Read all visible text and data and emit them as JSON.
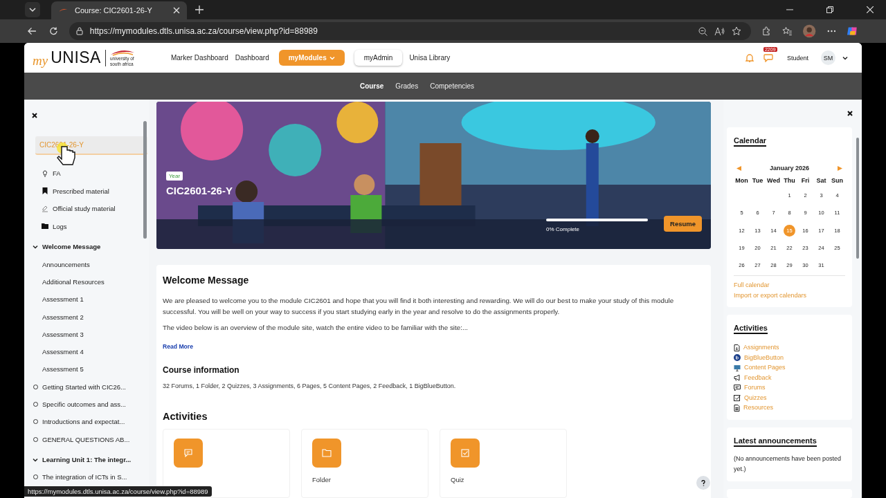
{
  "browser": {
    "tab_title": "Course: CIC2601-26-Y",
    "url": "https://mymodules.dtls.unisa.ac.za/course/view.php?id=88989",
    "status_url": "https://mymodules.dtls.unisa.ac.za/course/view.php?id=88989"
  },
  "header": {
    "logo": {
      "my": "my",
      "name": "UNISA",
      "tagline": "university of south africa"
    },
    "nav": [
      {
        "label": "Marker Dashboard",
        "kind": "link"
      },
      {
        "label": "Dashboard",
        "kind": "link"
      },
      {
        "label": "myModules",
        "kind": "primary"
      },
      {
        "label": "myAdmin",
        "kind": "secondary"
      },
      {
        "label": "Unisa Library",
        "kind": "link"
      }
    ],
    "message_count": "2209",
    "role": "Student",
    "initials": "SM"
  },
  "secondary_nav": [
    {
      "label": "Course",
      "selected": true
    },
    {
      "label": "Grades",
      "selected": false
    },
    {
      "label": "Competencies",
      "selected": false
    }
  ],
  "course_index": {
    "course": {
      "label": "CIC2601-26-Y",
      "selected": true
    },
    "links": [
      {
        "label": "FA",
        "kind": "faq"
      },
      {
        "label": "Prescribed material",
        "kind": "bookmark"
      },
      {
        "label": "Official study material",
        "kind": "study"
      },
      {
        "label": "Logs",
        "kind": "folder"
      }
    ],
    "sections": [
      {
        "title": "Welcome Message",
        "expanded": true,
        "children": [
          {
            "label": "Announcements",
            "kind": "page"
          },
          {
            "label": "Additional Resources",
            "kind": "page"
          },
          {
            "label": "Assessment 1",
            "kind": "page"
          },
          {
            "label": "Assessment 2",
            "kind": "page"
          },
          {
            "label": "Assessment 3",
            "kind": "page"
          },
          {
            "label": "Assessment 4",
            "kind": "page"
          },
          {
            "label": "Assessment 5",
            "kind": "page"
          },
          {
            "label": "Getting Started with CIC26...",
            "kind": "activity"
          },
          {
            "label": "Specific outcomes and ass...",
            "kind": "activity"
          },
          {
            "label": "Introductions and expectat...",
            "kind": "activity"
          },
          {
            "label": "GENERAL QUESTIONS AB...",
            "kind": "activity"
          }
        ]
      },
      {
        "title": "Learning Unit 1: The integr...",
        "expanded": true,
        "children": [
          {
            "label": "The integration of ICTs in S...",
            "kind": "activity"
          }
        ]
      }
    ]
  },
  "hero": {
    "badge": "Year",
    "title": "CIC2601-26-Y",
    "progress": {
      "level": 0,
      "reading": "0% Complete"
    },
    "button": "Resume"
  },
  "welcome": {
    "title": "Welcome Message",
    "paragraphs": [
      "We are pleased to welcome you to the module CIC2601 and hope that you will find it both interesting and rewarding. We will do our best to make your study of this module successful. You will be well on your way to success if you start studying early in the year and resolve to do the assignments properly.",
      "The video below is an overview of the module site, watch the entire video to be familiar with the site:..."
    ],
    "read_more": "Read More",
    "info_title": "Course information",
    "info": "32 Forums, 1 Folder, 2 Quizzes, 3 Assignments, 6 Pages, 5 Content Pages, 2 Feedback, 1 BigBlueButton.",
    "activities_title": "Activities",
    "activities": [
      {
        "kind": "forum"
      },
      {
        "kind": "folder",
        "label": "Folder"
      },
      {
        "kind": "quiz",
        "label": "Quiz"
      }
    ]
  },
  "calendar": {
    "title": "Calendar",
    "month": "January 2026",
    "weekdays": [
      "Mon",
      "Tue",
      "Wed",
      "Thu",
      "Fri",
      "Sat",
      "Sun"
    ],
    "weeks": [
      [
        {
          "d": "1",
          "today": false
        },
        {
          "d": "2",
          "today": false
        },
        {
          "d": "3",
          "today": false
        },
        {
          "d": "4",
          "today": false
        }
      ],
      [
        {
          "d": "5",
          "today": false
        },
        {
          "d": "6",
          "today": false
        },
        {
          "d": "7",
          "today": false
        },
        {
          "d": "8",
          "today": false
        },
        {
          "d": "9",
          "today": false
        },
        {
          "d": "10",
          "today": false
        },
        {
          "d": "11",
          "today": false
        }
      ],
      [
        {
          "d": "12",
          "today": false
        },
        {
          "d": "13",
          "today": false
        },
        {
          "d": "14",
          "today": false
        },
        {
          "d": "15",
          "today": true
        },
        {
          "d": "16",
          "today": false
        },
        {
          "d": "17",
          "today": false
        },
        {
          "d": "18",
          "today": false
        }
      ],
      [
        {
          "d": "19",
          "today": false
        },
        {
          "d": "20",
          "today": false
        },
        {
          "d": "21",
          "today": false
        },
        {
          "d": "22",
          "today": false
        },
        {
          "d": "23",
          "today": false
        },
        {
          "d": "24",
          "today": false
        },
        {
          "d": "25",
          "today": false
        }
      ],
      [
        {
          "d": "26",
          "today": false
        },
        {
          "d": "27",
          "today": false
        },
        {
          "d": "28",
          "today": false
        },
        {
          "d": "29",
          "today": false
        },
        {
          "d": "30",
          "today": false
        },
        {
          "d": "31",
          "today": false
        }
      ]
    ],
    "links": [
      "Full calendar",
      "Import or export calendars"
    ]
  },
  "activities_block": {
    "title": "Activities",
    "items": [
      {
        "label": "Assignments",
        "kind": "assign"
      },
      {
        "label": "BigBlueButton",
        "kind": "bbb"
      },
      {
        "label": "Content Pages",
        "kind": "content"
      },
      {
        "label": "Feedback",
        "kind": "feedback"
      },
      {
        "label": "Forums",
        "kind": "forum"
      },
      {
        "label": "Quizzes",
        "kind": "quiz"
      },
      {
        "label": "Resources",
        "kind": "resource"
      }
    ]
  },
  "announcements": {
    "title": "Latest announcements",
    "text": "(No announcements have been posted yet.)"
  }
}
